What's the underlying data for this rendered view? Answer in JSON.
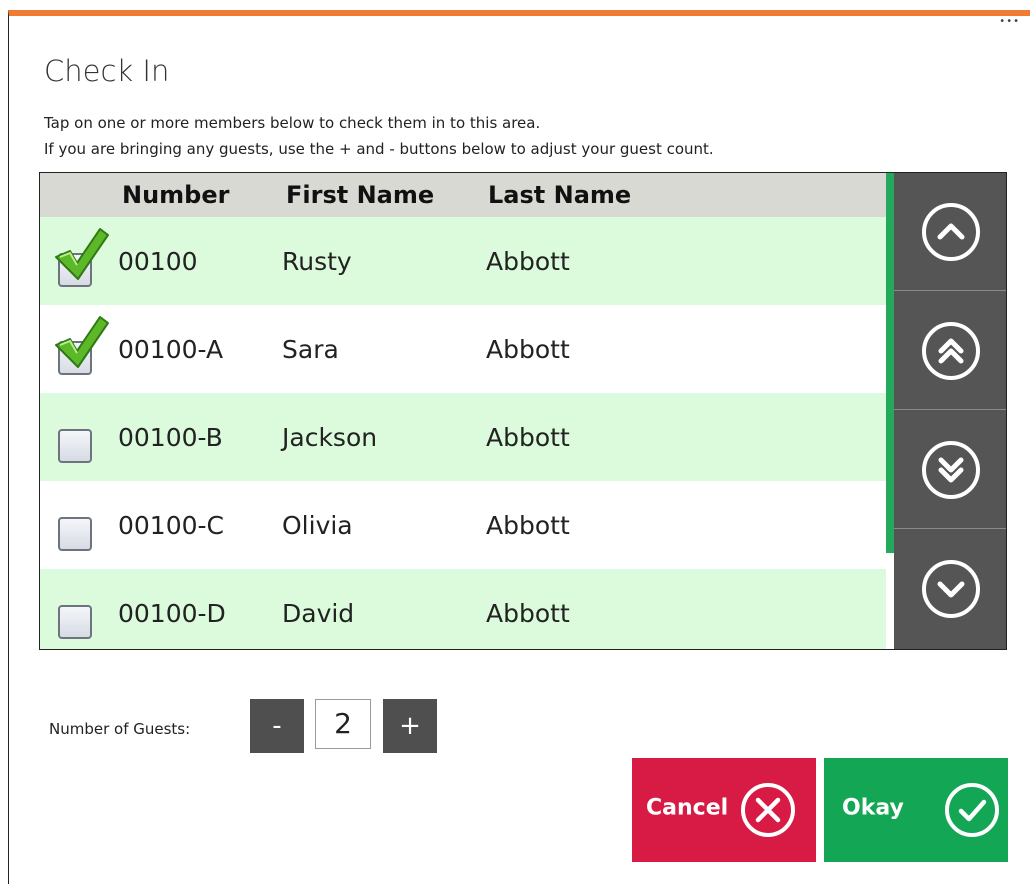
{
  "dialog": {
    "title": "Check In",
    "instruction_1": "Tap on one or more members below to check them in to this area.",
    "instruction_2": "If you are bringing any guests, use the + and - buttons below to adjust your guest count.",
    "corner_glyph": "•••"
  },
  "grid": {
    "headers": {
      "number": "Number",
      "first_name": "First Name",
      "last_name": "Last Name"
    },
    "rows": [
      {
        "number": "00100",
        "first_name": "Rusty",
        "last_name": "Abbott",
        "checked": true
      },
      {
        "number": "00100-A",
        "first_name": "Sara",
        "last_name": "Abbott",
        "checked": true
      },
      {
        "number": "00100-B",
        "first_name": "Jackson",
        "last_name": "Abbott",
        "checked": false
      },
      {
        "number": "00100-C",
        "first_name": "Olivia",
        "last_name": "Abbott",
        "checked": false
      },
      {
        "number": "00100-D",
        "first_name": "David",
        "last_name": "Abbott",
        "checked": false
      }
    ]
  },
  "scroll_buttons": [
    "chevron-up-icon",
    "double-chevron-up-icon",
    "double-chevron-down-icon",
    "chevron-down-icon"
  ],
  "guests": {
    "label": "Number of Guests:",
    "minus_label": "-",
    "value": "2",
    "plus_label": "+"
  },
  "actions": {
    "cancel_label": "Cancel",
    "okay_label": "Okay"
  },
  "colors": {
    "accent_orange": "#f07b35",
    "row_alt_green": "#dcfbdc",
    "cancel_red": "#d81b45",
    "okay_green": "#13a654",
    "scroll_panel": "#555555",
    "scrollbar_green": "#23a85c"
  }
}
